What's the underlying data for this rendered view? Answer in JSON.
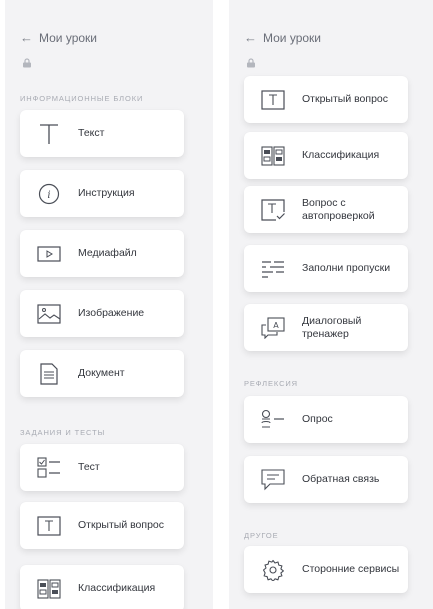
{
  "back_label": "Мои уроки",
  "sections": {
    "info_blocks": "ИНФОРМАЦИОННЫЕ БЛОКИ",
    "tasks_tests": "ЗАДАНИЯ И ТЕСТЫ",
    "reflection": "РЕФЛЕКСИЯ",
    "other": "ДРУГОЕ"
  },
  "left_items": [
    {
      "icon": "text-icon",
      "label": "Текст"
    },
    {
      "icon": "info-icon",
      "label": "Инструкция"
    },
    {
      "icon": "media-file-icon",
      "label": "Медиафайл"
    },
    {
      "icon": "image-icon",
      "label": "Изображение"
    },
    {
      "icon": "document-icon",
      "label": "Документ"
    },
    {
      "icon": "test-list-icon",
      "label": "Тест"
    },
    {
      "icon": "open-question-icon",
      "label": "Открытый вопрос"
    },
    {
      "icon": "classification-icon",
      "label": "Классификация"
    }
  ],
  "right_items": [
    {
      "icon": "open-question-icon",
      "label": "Открытый вопрос"
    },
    {
      "icon": "classification-icon",
      "label": "Классификация"
    },
    {
      "icon": "auto-check-question-icon",
      "label": "Вопрос с автопроверкой"
    },
    {
      "icon": "fill-gaps-icon",
      "label": "Заполни пропуски"
    },
    {
      "icon": "dialog-trainer-icon",
      "label": "Диалоговый тренажер"
    },
    {
      "icon": "survey-icon",
      "label": "Опрос"
    },
    {
      "icon": "feedback-icon",
      "label": "Обратная связь"
    },
    {
      "icon": "gear-icon",
      "label": "Сторонние сервисы"
    }
  ],
  "colors": {
    "panel_bg": "#f3f3f5",
    "card_bg": "#ffffff",
    "text": "#33363d",
    "muted": "#a8abb3",
    "icon": "#4a4e57"
  }
}
